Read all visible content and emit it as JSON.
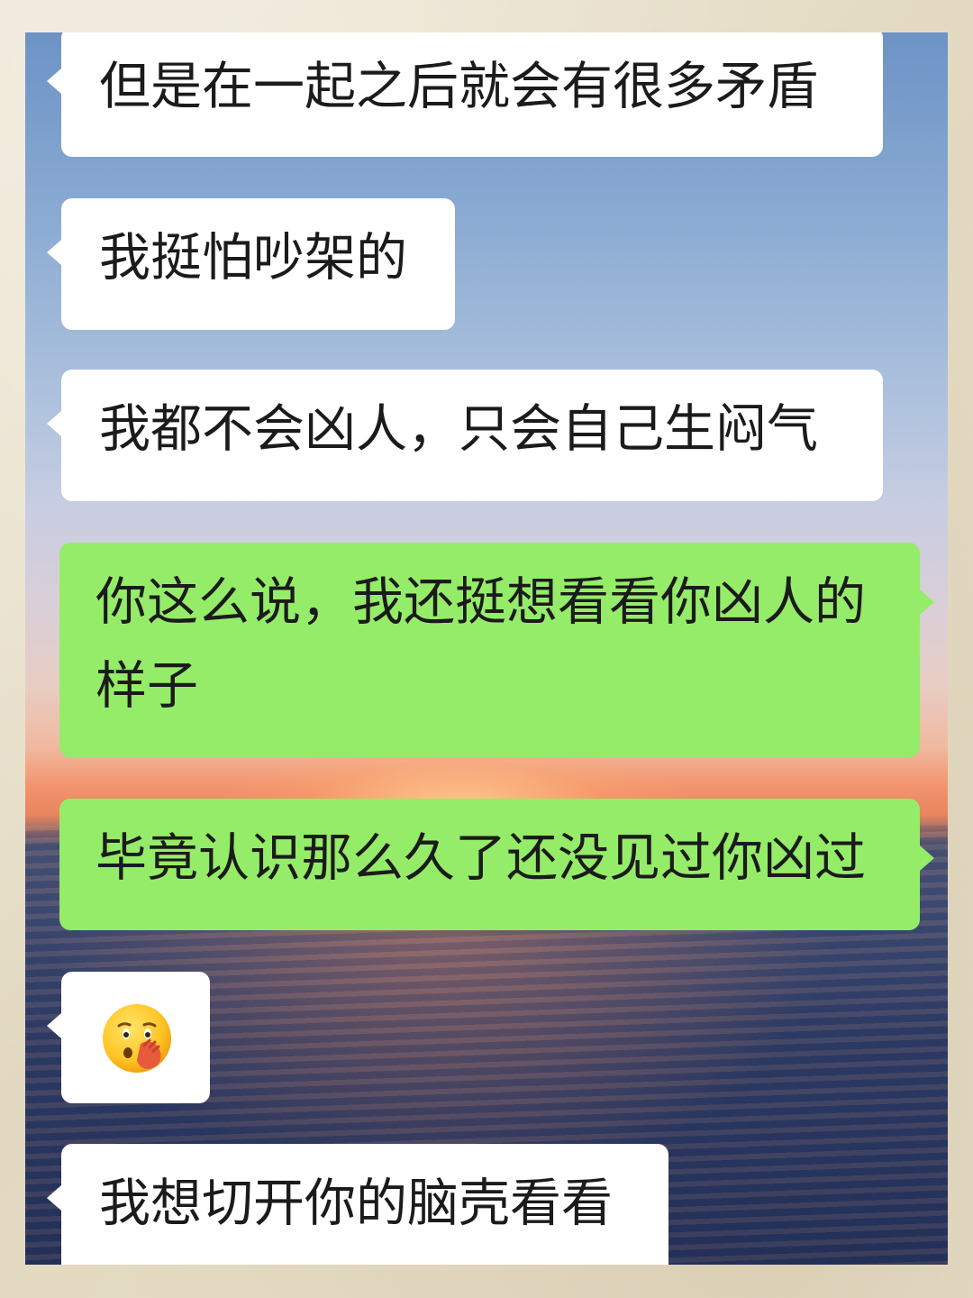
{
  "messages": [
    {
      "side": "left",
      "text": "但是在一起之后就会有很多矛盾"
    },
    {
      "side": "left",
      "text": "我挺怕吵架的"
    },
    {
      "side": "left",
      "text": "我都不会凶人，只会自己生闷气"
    },
    {
      "side": "right",
      "text": "你这么说，我还挺想看看你凶人的样子"
    },
    {
      "side": "right",
      "text": "毕竟认识那么久了还没见过你凶过"
    },
    {
      "side": "left",
      "emoji": "face-with-hand-over-mouth-emoji"
    },
    {
      "side": "left",
      "text": "我想切开你的脑壳看看"
    }
  ],
  "colors": {
    "incoming_bubble": "#ffffff",
    "outgoing_bubble": "#95ec69"
  }
}
